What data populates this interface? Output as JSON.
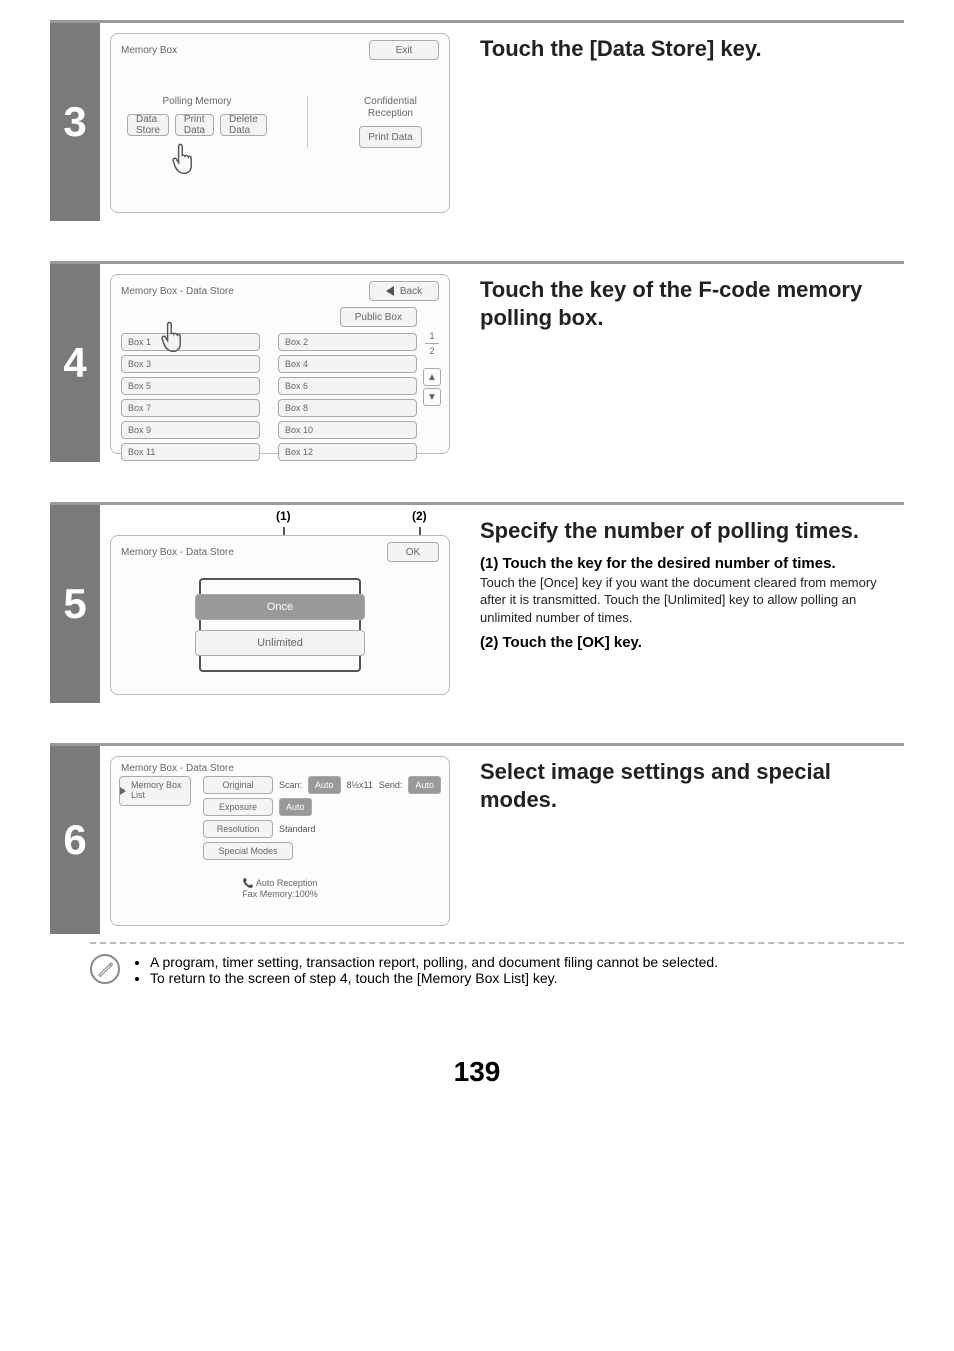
{
  "page_number": "139",
  "steps": {
    "3": {
      "heading": "Touch the [Data Store] key.",
      "screen": {
        "title": "Memory Box",
        "exit": "Exit",
        "polling_label": "Polling Memory",
        "conf_label": "Confidential\nReception",
        "btn_data_store": "Data Store",
        "btn_print_data1": "Print Data",
        "btn_delete_data": "Delete Data",
        "btn_print_data2": "Print Data"
      }
    },
    "4": {
      "heading": "Touch the key of the F-code memory polling box.",
      "screen": {
        "title": "Memory Box - Data Store",
        "back": "Back",
        "public_box": "Public Box",
        "page_cur": "1",
        "page_total": "2",
        "boxes": [
          "Box 1",
          "Box 2",
          "Box 3",
          "Box 4",
          "Box 5",
          "Box 6",
          "Box 7",
          "Box 8",
          "Box 9",
          "Box 10",
          "Box 11",
          "Box 12"
        ]
      }
    },
    "5": {
      "heading": "Specify the number of polling times.",
      "callout1": "(1)",
      "callout2": "(2)",
      "sub1_head": "(1) Touch the key for the desired number of times.",
      "sub1_body": "Touch the [Once] key if you want the document cleared from memory after it is transmitted. Touch the [Unlimited] key to allow polling an unlimited number of times.",
      "sub2_head": "(2) Touch the [OK] key.",
      "screen": {
        "title": "Memory Box - Data Store",
        "ok": "OK",
        "once": "Once",
        "unlimited": "Unlimited"
      }
    },
    "6": {
      "heading": "Select image settings and special modes.",
      "screen": {
        "title": "Memory Box - Data Store",
        "memory_box_list": "Memory Box List",
        "original": "Original",
        "scan_label": "Scan:",
        "scan_val": "Auto",
        "scan_size": "8½x11",
        "send_label": "Send:",
        "send_val": "Auto",
        "exposure": "Exposure",
        "exposure_val": "Auto",
        "resolution": "Resolution",
        "resolution_val": "Standard",
        "special_modes": "Special Modes",
        "status_line1": "Auto Reception",
        "status_line2": "Fax Memory:100%"
      },
      "note1": "A program, timer setting, transaction report, polling, and document filing cannot be selected.",
      "note2": "To return to the screen of step 4, touch the [Memory Box List] key."
    }
  }
}
